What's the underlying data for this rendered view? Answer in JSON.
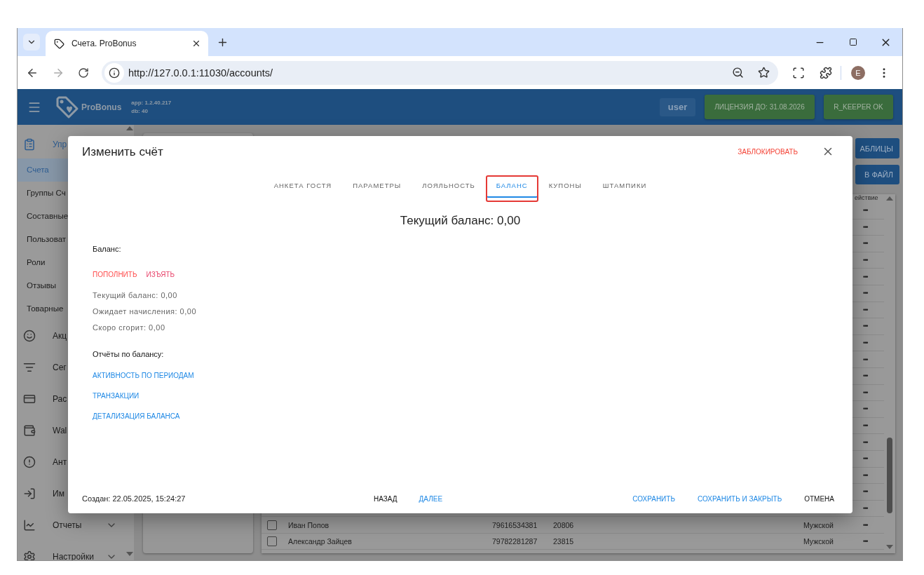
{
  "browser": {
    "tab_title": "Счета. ProBonus",
    "url": "http://127.0.0.1:11030/accounts/",
    "avatar": "E"
  },
  "app_header": {
    "brand": "ProBonus",
    "version_lines": [
      "app: 1.2.40.217",
      "db: 40"
    ],
    "user": "user",
    "badges": [
      "ЛИЦЕНЗИЯ ДО: 31.08.2026",
      "R_KEEPER OK"
    ]
  },
  "sidebar": {
    "items": [
      {
        "label": "Упр",
        "kind": "group",
        "expanded": true,
        "selected": false,
        "children": [
          {
            "label": "Счета",
            "selected": true
          },
          {
            "label": "Группы Сч",
            "selected": false
          },
          {
            "label": "Составные",
            "selected": false
          },
          {
            "label": "Пользоват",
            "selected": false
          },
          {
            "label": "Роли",
            "selected": false
          },
          {
            "label": "Отзывы",
            "selected": false
          },
          {
            "label": "Товарные",
            "selected": false
          }
        ]
      },
      {
        "label": "Акц",
        "kind": "link",
        "selected": false
      },
      {
        "label": "Сег",
        "kind": "link",
        "selected": false
      },
      {
        "label": "Рас",
        "kind": "link",
        "selected": false
      },
      {
        "label": "Wal",
        "kind": "link",
        "selected": false
      },
      {
        "label": "Ант",
        "kind": "link",
        "selected": false
      },
      {
        "label": "Им",
        "kind": "link",
        "selected": false
      },
      {
        "label": "Отчеты",
        "kind": "group",
        "expanded": false,
        "selected": false
      },
      {
        "label": "Настройки",
        "kind": "group",
        "expanded": false,
        "selected": false
      }
    ]
  },
  "background_page": {
    "buttons": [
      "АБЛИЦЫ",
      "В ФАЙЛ"
    ],
    "table": {
      "columns": [
        "ействие"
      ],
      "rows": [
        {
          "action": "•••"
        },
        {
          "action": "•••"
        },
        {
          "action": "•••"
        },
        {
          "action": "•••"
        },
        {
          "action": "•••"
        },
        {
          "action": "•••"
        },
        {
          "action": "•••"
        },
        {
          "action": "•••"
        },
        {
          "action": "•••"
        },
        {
          "action": "•••"
        },
        {
          "action": "•••"
        },
        {
          "action": "•••"
        },
        {
          "action": "•••"
        },
        {
          "action": "•••"
        },
        {
          "action": "•••"
        },
        {
          "action": "•••"
        },
        {
          "action": "•••"
        },
        {
          "action": "•••"
        },
        {
          "action": "•••"
        },
        {
          "checked": false,
          "name": "Иван Попов",
          "phone": "79616534381",
          "card": "20806",
          "gender": "Мужской",
          "action": "•••"
        },
        {
          "checked": false,
          "name": "Александр Зайцев",
          "phone": "79782281287",
          "card": "23815",
          "gender": "Мужской",
          "action": "•••"
        }
      ]
    }
  },
  "dialog": {
    "title": "Изменить счёт",
    "block_action": "ЗАБЛОКИРОВАТЬ",
    "tabs": [
      {
        "label": "АНКЕТА ГОСТЯ",
        "selected": false,
        "highlighted": false
      },
      {
        "label": "ПАРАМЕТРЫ",
        "selected": false,
        "highlighted": false
      },
      {
        "label": "ЛОЯЛЬНОСТЬ",
        "selected": false,
        "highlighted": false
      },
      {
        "label": "БАЛАНС",
        "selected": true,
        "highlighted": true
      },
      {
        "label": "КУПОНЫ",
        "selected": false,
        "highlighted": false
      },
      {
        "label": "ШТАМПИКИ",
        "selected": false,
        "highlighted": false
      }
    ],
    "heading": "Текущий баланс: 0,00",
    "balance_label": "Баланс:",
    "balance_actions": [
      {
        "label": "ПОПОЛНИТЬ",
        "color": "#ff4d4d"
      },
      {
        "label": "ИЗЪЯТЬ",
        "color": "#e8436a"
      }
    ],
    "stats": [
      "Текущий баланс: 0,00",
      "Ожидает начисления: 0,00",
      "Скоро сгорит: 0,00"
    ],
    "reports_label": "Отчёты по балансу:",
    "reports": [
      "АКТИВНОСТЬ ПО ПЕРИОДАМ",
      "ТРАНЗАКЦИИ",
      "ДЕТАЛИЗАЦИЯ БАЛАНСА"
    ],
    "created": "Создан: 22.05.2025, 15:24:27",
    "nav_buttons": [
      {
        "label": "НАЗАД",
        "kind": "plain"
      },
      {
        "label": "ДАЛЕЕ",
        "kind": "primary"
      }
    ],
    "action_buttons": [
      {
        "label": "СОХРАНИТЬ",
        "kind": "primary"
      },
      {
        "label": "СОХРАНИТЬ И ЗАКРЫТЬ",
        "kind": "primary"
      },
      {
        "label": "ОТМЕНА",
        "kind": "plain"
      }
    ]
  }
}
